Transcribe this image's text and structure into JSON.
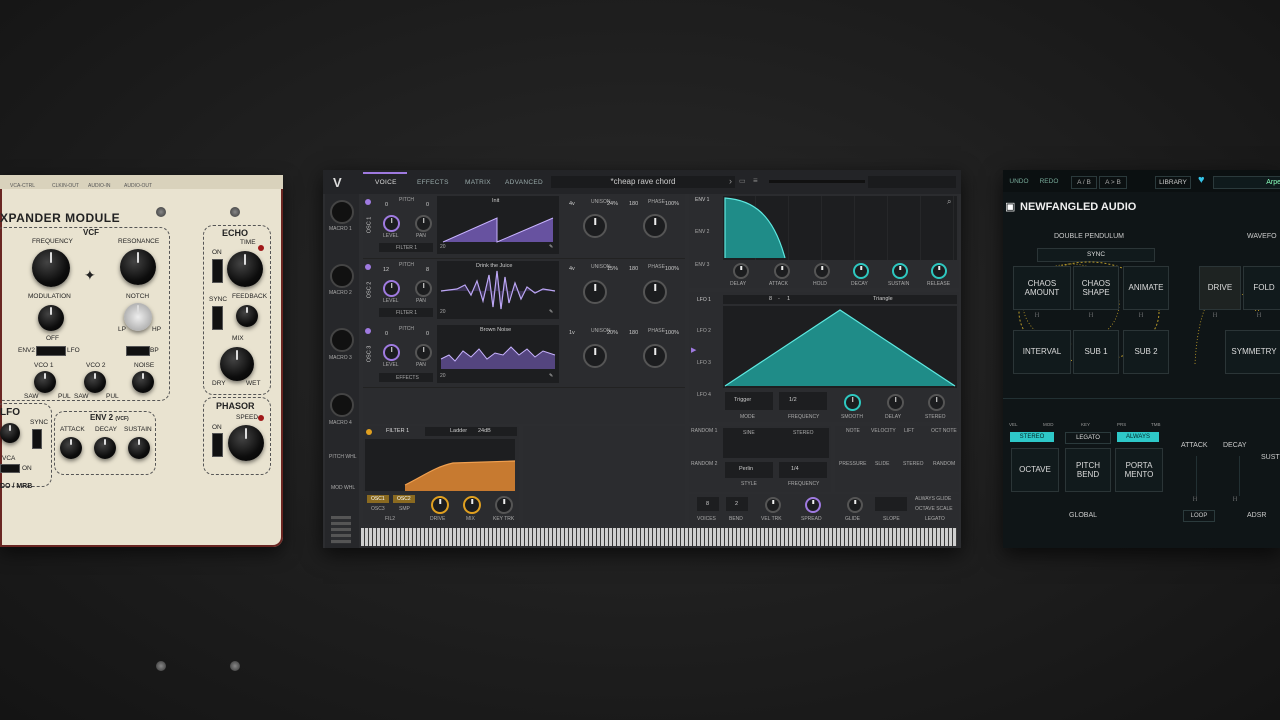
{
  "expander": {
    "title": "XPANDER MODULE",
    "jacks": [
      "VCA-CTRL",
      "CLKIN-OUT",
      "AUDIO-IN",
      "AUDIO-OUT"
    ],
    "vcf": {
      "title": "VCF",
      "frequency": "FREQUENCY",
      "resonance": "RESONANCE",
      "modulation": "MODULATION",
      "notch": "NOTCH",
      "off": "OFF",
      "lp": "LP",
      "hp": "HP",
      "env2": "ENV2",
      "lfo": "LFO",
      "bp": "BP"
    },
    "vco": {
      "vco1": "VCO 1",
      "vco2": "VCO 2",
      "noise": "NOISE",
      "saw": "SAW",
      "pul": "PUL"
    },
    "echo": {
      "title": "ECHO",
      "time": "TIME",
      "on": "ON",
      "sync": "SYNC",
      "feedback": "FEEDBACK",
      "mix": "MIX",
      "dry": "DRY",
      "wet": "WET"
    },
    "env2": {
      "title": "ENV 2",
      "sub": "(VCF)",
      "attack": "ATTACK",
      "decay": "DECAY",
      "sustain": "SUSTAIN"
    },
    "lfo": {
      "title": "LFO",
      "sync": "SYNC",
      "vca": "VCA",
      "on": "ON"
    },
    "phasor": {
      "title": "PHASOR",
      "speed": "SPEED",
      "on": "ON"
    },
    "brand": "DO / MRB"
  },
  "vital": {
    "tabs": [
      "VOICE",
      "EFFECTS",
      "MATRIX",
      "ADVANCED"
    ],
    "preset": "*cheap rave chord",
    "macros": [
      "MACRO 1",
      "MACRO 2",
      "MACRO 3",
      "MACRO 4"
    ],
    "pitch_whl": "PITCH WHL",
    "mod_whl": "MOD WHL",
    "oscs": [
      {
        "label": "OSC 1",
        "pitch_left": "0",
        "pitch_right": "0",
        "wave": "Init",
        "route": "FILTER 1",
        "unison": "4v",
        "unison_pct": "24%",
        "phase": "180",
        "phase_pct": "100%",
        "wt_count": "20"
      },
      {
        "label": "OSC 2",
        "pitch_left": "12",
        "pitch_right": "8",
        "wave": "Drink the Juice",
        "route": "FILTER 1",
        "unison": "4v",
        "unison_pct": "15%",
        "phase": "180",
        "phase_pct": "100%",
        "wt_count": "20"
      },
      {
        "label": "OSC 3",
        "pitch_left": "0",
        "pitch_right": "0",
        "wave": "Brown Noise",
        "route": "EFFECTS",
        "unison": "1v",
        "unison_pct": "20%",
        "phase": "180",
        "phase_pct": "100%",
        "wt_count": "20"
      }
    ],
    "osc_knobs": {
      "pitch": "PITCH",
      "level": "LEVEL",
      "pan": "PAN",
      "unison": "UNISON",
      "phase": "PHASE"
    },
    "filter": {
      "title": "FILTER 1",
      "type": "Ladder",
      "slope": "24dB",
      "osc1": "OSC1",
      "osc2": "OSC2",
      "osc3": "OSC3",
      "smp": "SMP",
      "fil2": "FIL2",
      "drive": "DRIVE",
      "mix": "MIX",
      "key_trk": "KEY TRK"
    },
    "envs": [
      "ENV 1",
      "ENV 2",
      "ENV 3"
    ],
    "env_knobs": [
      "DELAY",
      "ATTACK",
      "HOLD",
      "DECAY",
      "SUSTAIN",
      "RELEASE"
    ],
    "lfos": [
      "LFO 1",
      "LFO 2",
      "LFO 3",
      "LFO 4"
    ],
    "lfo_header": {
      "rate": "8",
      "sep": "-",
      "div": "1",
      "shape": "Triangle"
    },
    "lfo_controls": {
      "mode_value": "Trigger",
      "mode": "MODE",
      "freq_value": "1/2",
      "frequency": "FREQUENCY",
      "smooth": "SMOOTH",
      "delay": "DELAY",
      "stereo": "STEREO"
    },
    "randoms": [
      "RANDOM 1",
      "RANDOM 2"
    ],
    "random_controls": {
      "sine": "SINE",
      "stereo": "STEREO",
      "style_value": "Perlin",
      "style": "STYLE",
      "freq_value": "1/4",
      "frequency": "FREQUENCY"
    },
    "mod_sources": [
      "NOTE",
      "VELOCITY",
      "LIFT",
      "OCT NOTE",
      "PRESSURE",
      "SLIDE",
      "STEREO",
      "RANDOM"
    ],
    "voice": {
      "voices_value": "8",
      "voices": "VOICES",
      "bend_value": "2",
      "bend": "BEND",
      "vel_trk": "VEL TRK",
      "spread": "SPREAD",
      "glide": "GLIDE",
      "slope": "SLOPE",
      "always_glide": "ALWAYS GLIDE",
      "octave_scale": "OCTAVE SCALE",
      "legato": "LEGATO"
    }
  },
  "newfangled": {
    "undo": "UNDO",
    "redo": "REDO",
    "ab": "A / B",
    "a_to_b": "A > B",
    "library": "LIBRARY",
    "preset": "Arpe",
    "brand": "NEWFANGLED AUDIO",
    "double_pendulum": "DOUBLE PENDULUM",
    "waveform": "WAVEFO",
    "sync": "SYNC",
    "grid": [
      [
        "CHAOS AMOUNT",
        "CHAOS SHAPE",
        "ANIMATE"
      ],
      [
        "INTERVAL",
        "SUB 1",
        "SUB 2"
      ]
    ],
    "wave_cells": [
      "DRIVE",
      "FOLD",
      "SYMMETRY"
    ],
    "mod_tiny": [
      "VEL",
      "MOD",
      "KEY",
      "PRS",
      "TMB"
    ],
    "stereo": "STEREO",
    "legato": "LEGATO",
    "always": "ALWAYS",
    "global_cells": [
      "OCTAVE",
      "PITCH BEND",
      "PORTA MENTO"
    ],
    "global": "GLOBAL",
    "attack": "ATTACK",
    "decay": "DECAY",
    "sustain": "SUST",
    "loop": "LOOP",
    "adsr": "ADSR",
    "colors": {
      "accent": "#2ec8c8",
      "heart": "#35c4e8"
    }
  }
}
